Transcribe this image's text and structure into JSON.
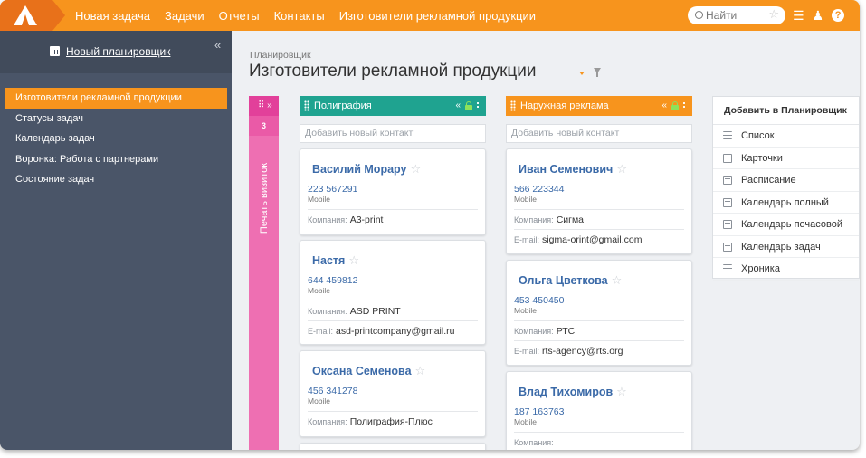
{
  "topbar": {
    "nav": [
      "Новая задача",
      "Задачи",
      "Отчеты",
      "Контакты",
      "Изготовители рекламной продукции"
    ],
    "search_placeholder": "Найти"
  },
  "sidebar": {
    "title": "Новый планировщик",
    "items": [
      {
        "label": "Изготовители рекламной продукции",
        "active": true
      },
      {
        "label": "Статусы задач"
      },
      {
        "label": "Календарь задач"
      },
      {
        "label": "Воронка: Работа с партнерами"
      },
      {
        "label": "Состояние задач"
      }
    ]
  },
  "main": {
    "breadcrumb": "Планировщик",
    "title": "Изготовители рекламной продукции"
  },
  "pink_column": {
    "count": "3",
    "label": "Печать визиток"
  },
  "columns": [
    {
      "title": "Полиграфия",
      "color": "#1fa390",
      "add_placeholder": "Добавить новый контакт",
      "cards": [
        {
          "name": "Василий Морару",
          "phone": "223 567291",
          "phone_type": "Mobile",
          "company_label": "Компания:",
          "company": "А3-print"
        },
        {
          "name": "Настя",
          "phone": "644 459812",
          "phone_type": "Mobile",
          "company_label": "Компания:",
          "company": "ASD PRINT",
          "email_label": "E-mail:",
          "email": "asd-printcompany@gmail.ru"
        },
        {
          "name": "Оксана Семенова",
          "phone": "456 341278",
          "phone_type": "Mobile",
          "company_label": "Компания:",
          "company": "Полиграфия-Плюс"
        }
      ]
    },
    {
      "title": "Наружная реклама",
      "color": "#f7941d",
      "add_placeholder": "Добавить новый контакт",
      "cards": [
        {
          "name": "Иван Семенович",
          "phone": "566 223344",
          "phone_type": "Mobile",
          "company_label": "Компания:",
          "company": "Сигма",
          "email_label": "E-mail:",
          "email": "sigma-orint@gmail.com"
        },
        {
          "name": "Ольга Цветкова",
          "phone": "453 450450",
          "phone_type": "Mobile",
          "company_label": "Компания:",
          "company": "РТС",
          "email_label": "E-mail:",
          "email": "rts-agency@rts.org"
        },
        {
          "name": "Влад Тихомиров",
          "phone": "187 163763",
          "phone_type": "Mobile",
          "company_label": "Компания:",
          "company": ""
        }
      ]
    }
  ],
  "right_panel": {
    "title": "Добавить в Планировщик",
    "items": [
      {
        "label": "Список",
        "icon": "list-icon"
      },
      {
        "label": "Карточки",
        "icon": "cards-icon"
      },
      {
        "label": "Расписание",
        "icon": "schedule-icon"
      },
      {
        "label": "Календарь полный",
        "icon": "calendar-icon"
      },
      {
        "label": "Календарь почасовой",
        "icon": "calendar-hourly-icon"
      },
      {
        "label": "Календарь задач",
        "icon": "calendar-tasks-icon"
      },
      {
        "label": "Хроника",
        "icon": "timeline-icon"
      }
    ]
  }
}
